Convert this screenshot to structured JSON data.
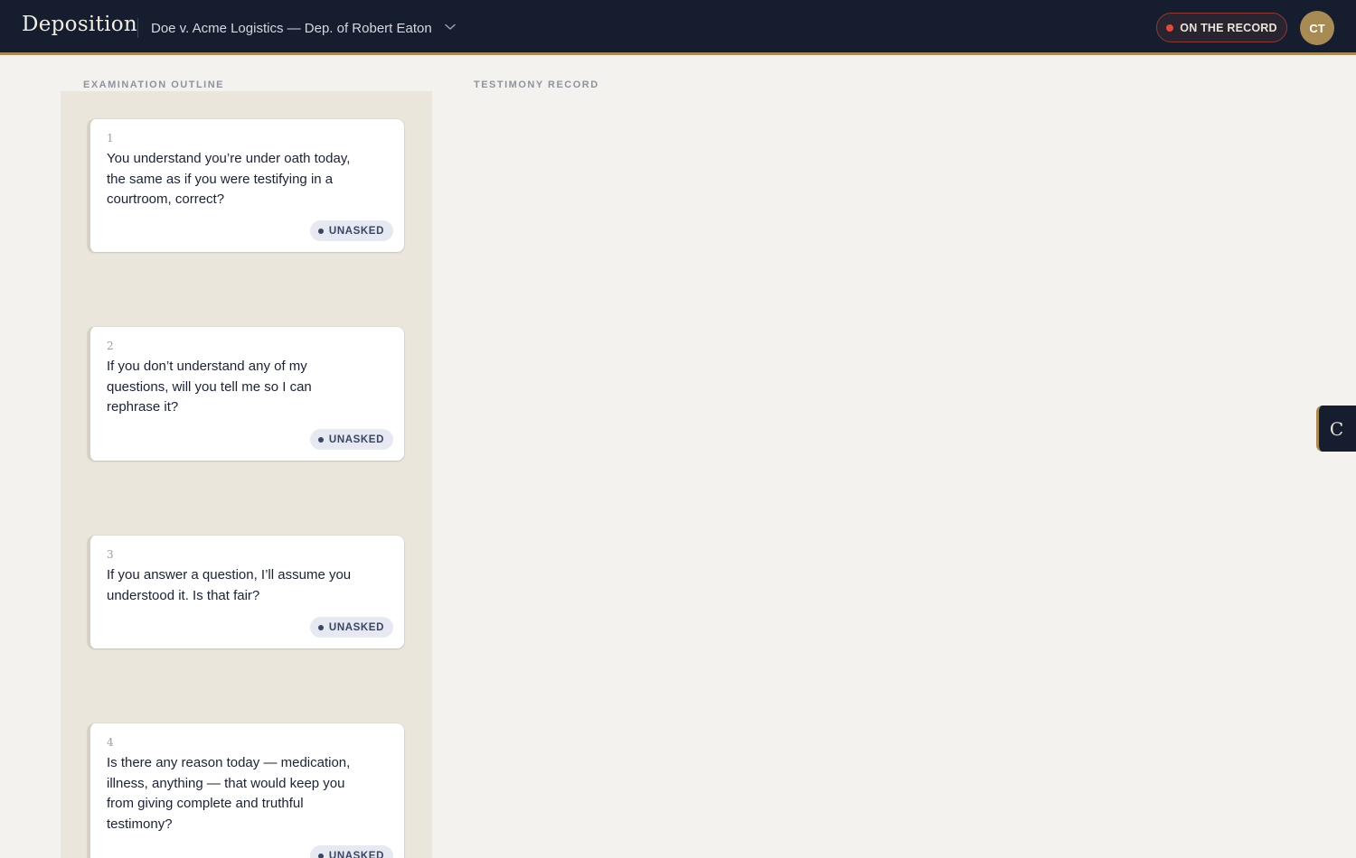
{
  "header": {
    "brand": "Deposition",
    "case_title": "Doe v. Acme Logistics — Dep. of Robert Eaton",
    "record_status": "ON THE RECORD",
    "record_color": "#e04a3a",
    "avatar_initials": "CT",
    "accent_color": "#a88a55",
    "dropdown_icon": "chevron-down-icon"
  },
  "outline": {
    "label": "EXAMINATION OUTLINE",
    "questions": [
      {
        "num": "1",
        "text": "You understand you’re under oath today, the same as if you were testifying in a courtroom, correct?",
        "status": "UNASKED"
      },
      {
        "num": "2",
        "text": "If you don’t understand any of my questions, will you tell me so I can rephrase it?",
        "status": "UNASKED"
      },
      {
        "num": "3",
        "text": "If you answer a question, I’ll assume you understood it. Is that fair?",
        "status": "UNASKED"
      },
      {
        "num": "4",
        "text": "Is there any reason today — medication, illness, anything — that would keep you from giving complete and truthful testimony?",
        "status": "UNASKED"
      }
    ]
  },
  "testimony": {
    "label": "TESTIMONY RECORD"
  },
  "side_tab": {
    "label": "C"
  }
}
